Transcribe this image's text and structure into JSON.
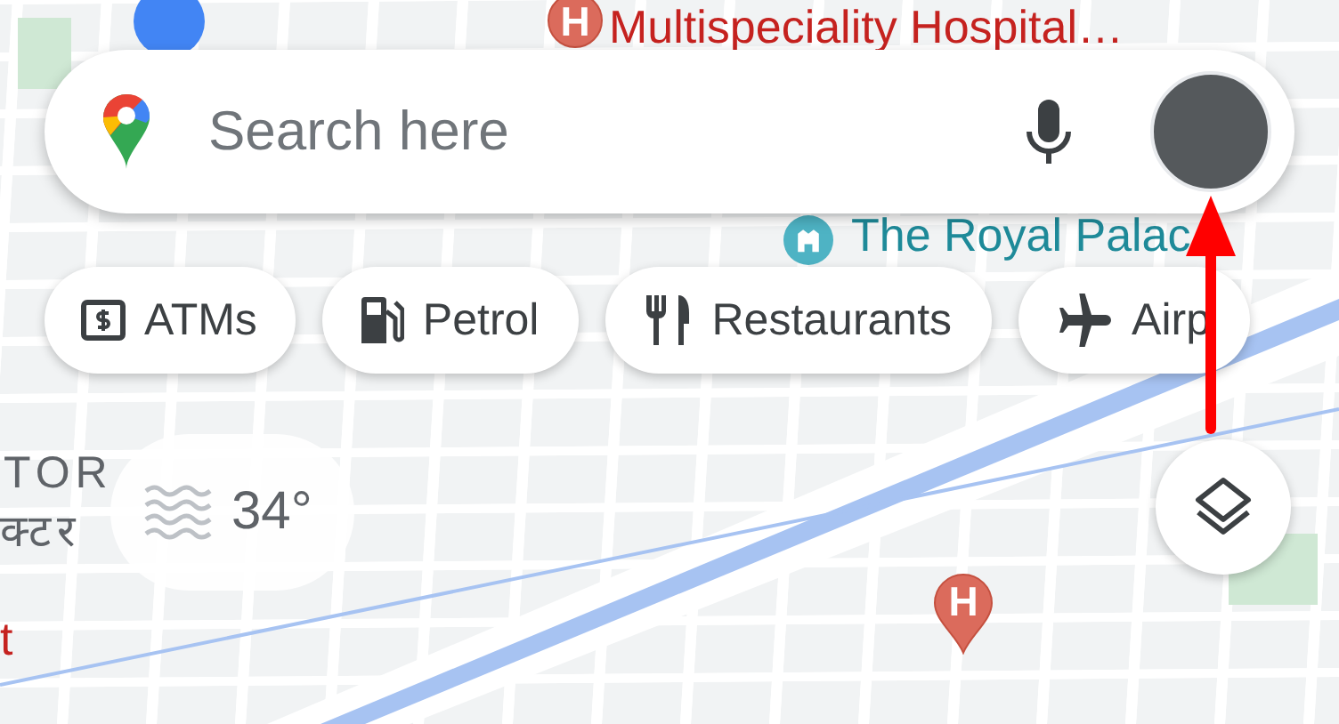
{
  "search": {
    "placeholder": "Search here"
  },
  "chips": [
    {
      "label": "ATMs",
      "kind": "atm"
    },
    {
      "label": "Petrol",
      "kind": "petrol"
    },
    {
      "label": "Restaurants",
      "kind": "restaurant"
    },
    {
      "label": "Airp",
      "kind": "airport"
    }
  ],
  "weather": {
    "temperature": "34°"
  },
  "map_labels": [
    {
      "text": "Multispeciality Hospital…",
      "kind": "hospital"
    },
    {
      "text": "The Royal Palac",
      "kind": "landmark"
    },
    {
      "text": "TOR",
      "kind": "area"
    },
    {
      "text": "क्टर",
      "kind": "area"
    },
    {
      "text": "t",
      "kind": "hospital"
    }
  ],
  "map_pins": [
    {
      "symbol": "H"
    },
    {
      "symbol": "H"
    }
  ]
}
